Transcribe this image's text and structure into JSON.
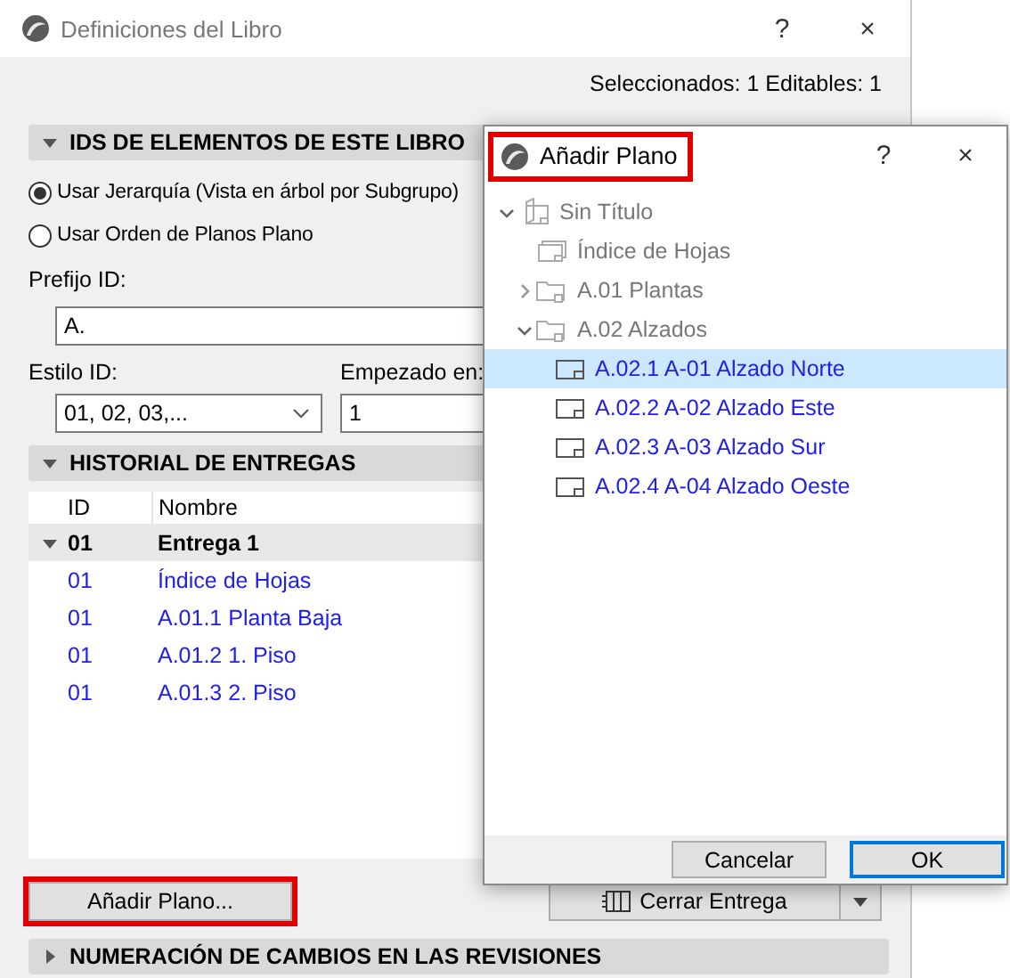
{
  "main_window": {
    "title": "Definiciones del Libro",
    "help": "?",
    "close": "×",
    "selection_status": "Seleccionados: 1 Editables: 1",
    "id_section": {
      "title": "IDS DE ELEMENTOS DE ESTE LIBRO",
      "expanded": true,
      "options": [
        {
          "label": "Usar Jerarquía (Vista en árbol por Subgrupo)",
          "selected": true
        },
        {
          "label": "Usar Orden de Planos Plano",
          "selected": false
        }
      ],
      "prefix_label": "Prefijo ID:",
      "prefix_value": "A.",
      "style_label": "Estilo ID:",
      "style_value": "01, 02, 03,...",
      "start_label": "Empezado en:",
      "start_value": "1"
    },
    "history_section": {
      "title": "HISTORIAL DE ENTREGAS",
      "expanded": true,
      "columns": [
        "ID",
        "Nombre"
      ],
      "rows": [
        {
          "id": "01",
          "name": "Entrega 1",
          "expanded": true,
          "children": [
            {
              "id": "01",
              "name": "Índice de Hojas"
            },
            {
              "id": "01",
              "name": "A.01.1 Planta Baja"
            },
            {
              "id": "01",
              "name": "A.01.2 1. Piso"
            },
            {
              "id": "01",
              "name": "A.01.3 2. Piso"
            }
          ]
        }
      ]
    },
    "add_button": {
      "label": "Añadir Plano...",
      "highlighted": true
    },
    "close_issue_button": {
      "label": "Cerrar Entrega"
    },
    "revision_section": {
      "title": "NUMERACIÓN DE CAMBIOS EN LAS REVISIONES",
      "expanded": false
    }
  },
  "dialog": {
    "title": "Añadir Plano",
    "title_highlighted": true,
    "help": "?",
    "close": "×",
    "tree": [
      {
        "label": "Sin Título",
        "kind": "book",
        "expanded": true,
        "selected": false,
        "children": [
          {
            "label": "Índice de Hojas",
            "kind": "index",
            "selected": false
          },
          {
            "label": "A.01 Plantas",
            "kind": "folder",
            "expanded": false,
            "selected": false
          },
          {
            "label": "A.02 Alzados",
            "kind": "folder",
            "expanded": true,
            "selected": false,
            "children": [
              {
                "label": "A.02.1 A-01 Alzado Norte",
                "kind": "sheet",
                "selected": true
              },
              {
                "label": "A.02.2 A-02 Alzado Este",
                "kind": "sheet",
                "selected": false
              },
              {
                "label": "A.02.3 A-03 Alzado Sur",
                "kind": "sheet",
                "selected": false
              },
              {
                "label": "A.02.4 A-04 Alzado Oeste",
                "kind": "sheet",
                "selected": false
              }
            ]
          }
        ]
      }
    ],
    "buttons": [
      {
        "label": "Cancelar",
        "default": false
      },
      {
        "label": "OK",
        "default": true
      }
    ]
  }
}
